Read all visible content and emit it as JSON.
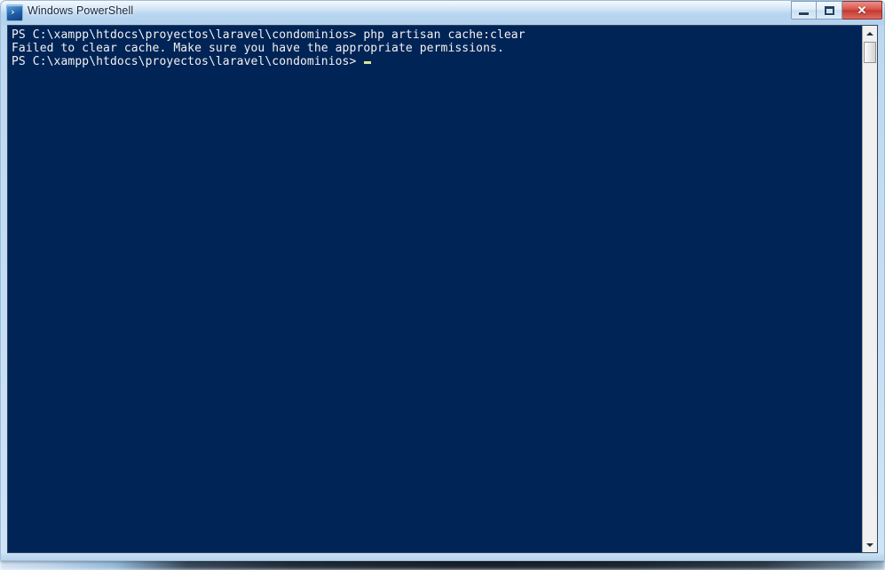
{
  "window": {
    "title": "Windows PowerShell",
    "icon": "powershell-icon",
    "icon_glyph": "›",
    "colors": {
      "console_background": "#012456",
      "console_text": "#f2f2f2",
      "cursor": "#d7e894",
      "titlebar_glass": "#b7d4ef",
      "close_button": "#c03a31"
    }
  },
  "caption_buttons": {
    "minimize_label": "–",
    "maximize_label": "□",
    "close_label": "✕"
  },
  "console": {
    "lines": [
      "PS C:\\xampp\\htdocs\\proyectos\\laravel\\condominios> php artisan cache:clear",
      "Failed to clear cache. Make sure you have the appropriate permissions.",
      "PS C:\\xampp\\htdocs\\proyectos\\laravel\\condominios> "
    ],
    "prompt": "PS C:\\xampp\\htdocs\\proyectos\\laravel\\condominios> ",
    "command": "php artisan cache:clear",
    "error_message": "Failed to clear cache. Make sure you have the appropriate permissions.",
    "cursor_visible": true
  },
  "scrollbar": {
    "up_arrow": "▲",
    "down_arrow": "▼",
    "thumb_position": "top"
  }
}
